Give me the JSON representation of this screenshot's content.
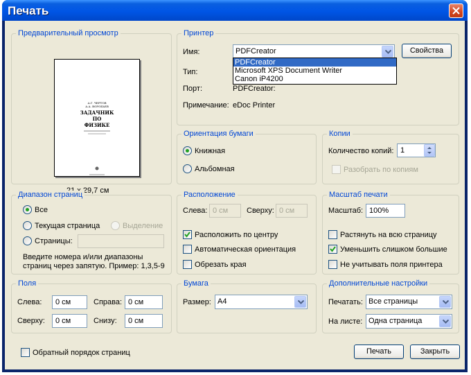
{
  "window": {
    "title": "Печать"
  },
  "preview": {
    "legend": "Предварительный просмотр",
    "size_label": "21 x 29,7 см",
    "book": {
      "authors": "А.Г. ЧЕРТОВ\nА.А. ВОРОБЬЕВ",
      "title_line1": "ЗАДАЧНИК",
      "title_line2": "ПО",
      "title_line3": "ФИЗИКЕ"
    }
  },
  "printer": {
    "legend": "Принтер",
    "name_label": "Имя:",
    "name_value": "PDFCreator",
    "properties_button": "Свойства",
    "dropdown_options": [
      "PDFCreator",
      "Microsoft XPS Document Writer",
      "Canon iP4200"
    ],
    "type_label": "Тип:",
    "port_label": "Порт:",
    "port_value": "PDFCreator:",
    "comment_label": "Примечание:",
    "comment_value": "eDoc Printer"
  },
  "orientation": {
    "legend": "Ориентация бумаги",
    "portrait": "Книжная",
    "landscape": "Альбомная",
    "selected": "portrait"
  },
  "copies": {
    "legend": "Копии",
    "count_label": "Количество копий:",
    "count_value": "1",
    "collate_label": "Разобрать по копиям"
  },
  "range": {
    "legend": "Диапазон страниц",
    "all": "Все",
    "current": "Текущая страница",
    "selection": "Выделение",
    "pages": "Страницы:",
    "hint": "Введите номера и/или диапазоны\nстраниц через запятую. Пример: 1,3,5-9"
  },
  "layout": {
    "legend": "Расположение",
    "left_label": "Слева:",
    "left_value": "0 см",
    "top_label": "Сверху:",
    "top_value": "0 см",
    "center": "Расположить по центру",
    "auto_orient": "Автоматическая ориентация",
    "crop": "Обрезать края"
  },
  "scale": {
    "legend": "Масштаб печати",
    "scale_label": "Масштаб:",
    "scale_value": "100%",
    "stretch": "Растянуть на всю страницу",
    "shrink": "Уменьшить слишком большие",
    "ignore_margins": "Не учитывать поля принтера"
  },
  "margins": {
    "legend": "Поля",
    "left_label": "Слева:",
    "left_value": "0 см",
    "right_label": "Справа:",
    "right_value": "0 см",
    "top_label": "Сверху:",
    "top_value": "0 см",
    "bottom_label": "Снизу:",
    "bottom_value": "0 см"
  },
  "paper": {
    "legend": "Бумага",
    "size_label": "Размер:",
    "size_value": "A4"
  },
  "advanced": {
    "legend": "Дополнительные настройки",
    "print_label": "Печатать:",
    "print_value": "Все страницы",
    "per_sheet_label": "На листе:",
    "per_sheet_value": "Одна страница"
  },
  "footer": {
    "reverse_label": "Обратный порядок страниц",
    "print_button": "Печать",
    "close_button": "Закрыть"
  },
  "colors": {
    "legend": "#0046d5",
    "title_bar": "#0055e5",
    "dialog_bg": "#ece9d8",
    "selection": "#316ac5"
  }
}
